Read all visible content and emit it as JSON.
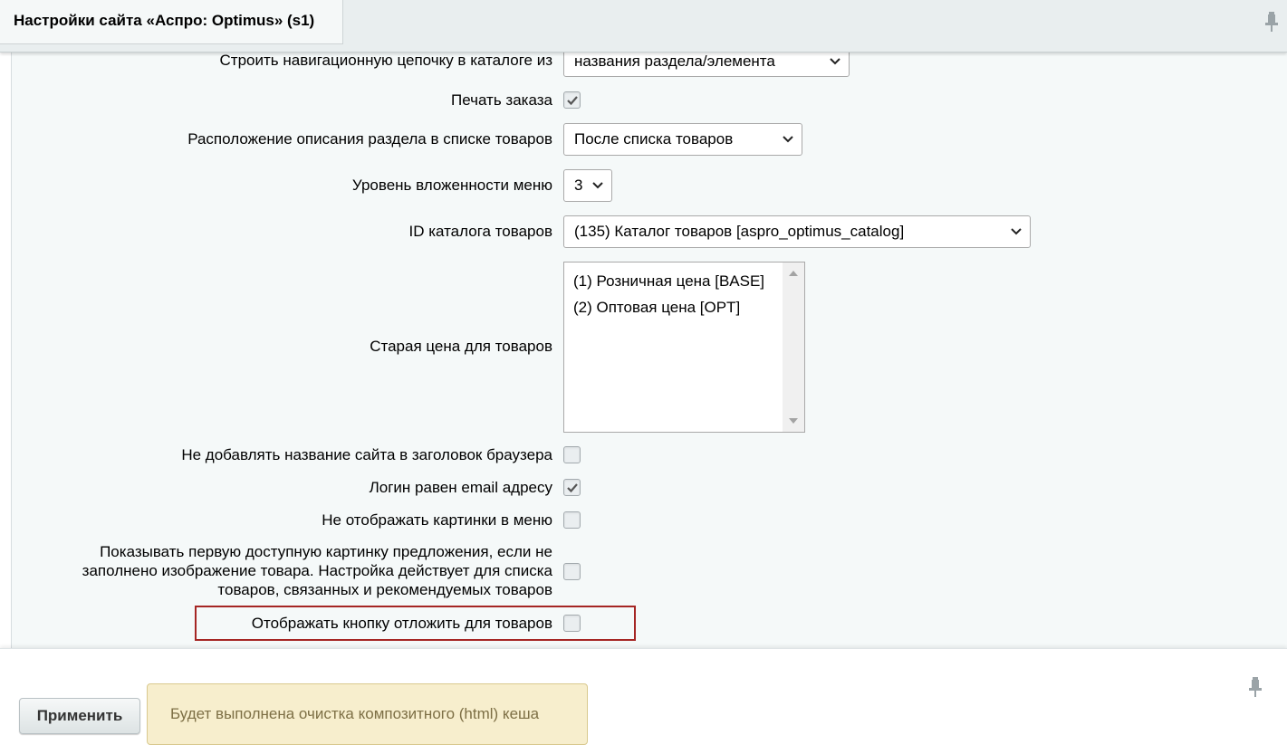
{
  "header": {
    "title": "Настройки сайта «Аспро: Optimus» (s1)"
  },
  "settings": {
    "nav_chain": {
      "label": "Строить навигационную цепочку в каталоге из",
      "value": "названия раздела/элемента"
    },
    "print_order": {
      "label": "Печать заказа",
      "checked": true
    },
    "section_desc_position": {
      "label": "Расположение описания раздела в списке товаров",
      "value": "После списка товаров"
    },
    "menu_depth": {
      "label": "Уровень вложенности меню",
      "value": "3"
    },
    "catalog_id": {
      "label": "ID каталога товаров",
      "value": "(135) Каталог товаров [aspro_optimus_catalog]"
    },
    "old_price": {
      "label": "Старая цена для товаров",
      "options": [
        "(1) Розничная цена [BASE]",
        "(2) Оптовая цена [OPT]"
      ]
    },
    "no_site_title": {
      "label": "Не добавлять название сайта в заголовок браузера",
      "checked": false
    },
    "login_email": {
      "label": "Логин равен email адресу",
      "checked": true
    },
    "no_menu_images": {
      "label": "Не отображать картинки в меню",
      "checked": false
    },
    "first_offer_image": {
      "label": "Показывать первую доступную картинку предложения, если не заполнено изображение товара. Настройка действует для списка товаров, связанных и рекомендуемых товаров",
      "checked": false
    },
    "show_delay_button": {
      "label": "Отображать кнопку отложить для товаров",
      "checked": false
    }
  },
  "footer": {
    "apply_label": "Применить",
    "note": "Будет выполнена очистка композитного (html) кеша"
  },
  "colors": {
    "highlight": "#a52624",
    "note_bg": "#f7eecd",
    "panel_bg": "#f5f9f9"
  },
  "icons": [
    "pin-icon",
    "chevron-down-icon",
    "checkmark-icon",
    "scroll-up-arrow-icon",
    "scroll-down-arrow-icon"
  ]
}
